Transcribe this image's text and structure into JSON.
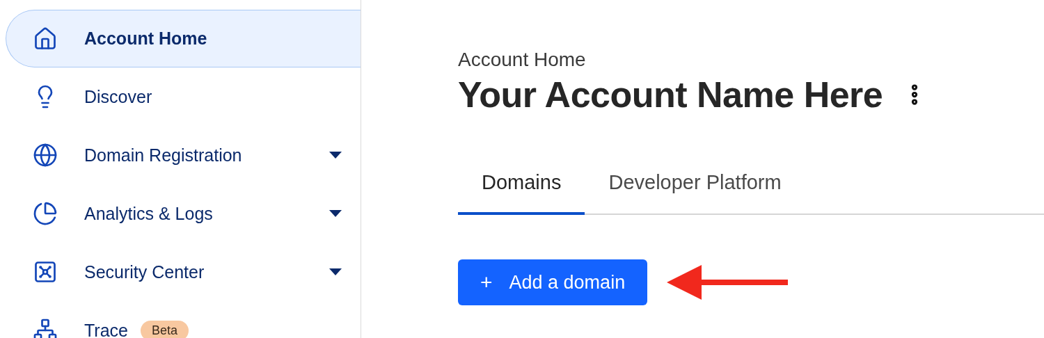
{
  "sidebar": {
    "items": [
      {
        "label": "Account Home",
        "selected": true,
        "has_menu": false
      },
      {
        "label": "Discover",
        "selected": false,
        "has_menu": false
      },
      {
        "label": "Domain Registration",
        "selected": false,
        "has_menu": true
      },
      {
        "label": "Analytics & Logs",
        "selected": false,
        "has_menu": true
      },
      {
        "label": "Security Center",
        "selected": false,
        "has_menu": true
      },
      {
        "label": "Trace",
        "selected": false,
        "has_menu": false,
        "badge": "Beta"
      }
    ]
  },
  "breadcrumb": "Account Home",
  "title": "Your Account Name Here",
  "tabs": [
    {
      "label": "Domains",
      "selected": true
    },
    {
      "label": "Developer Platform",
      "selected": false
    }
  ],
  "primary_button": {
    "icon": "+",
    "label": "Add a domain"
  }
}
